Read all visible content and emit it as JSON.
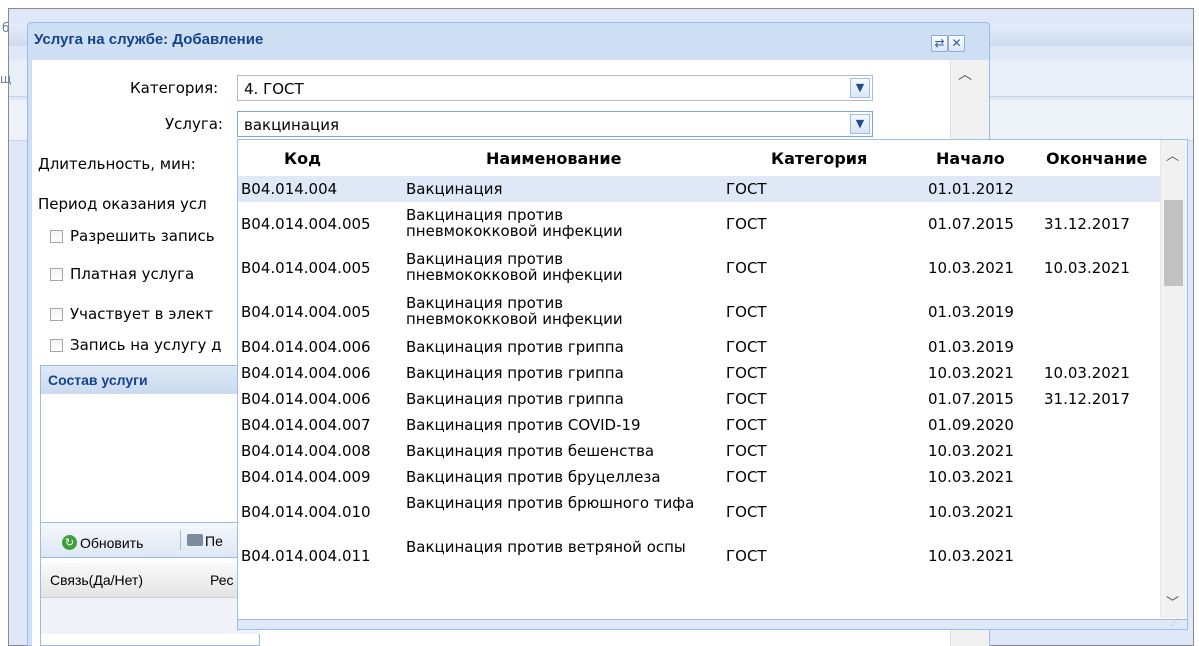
{
  "background": {
    "tab_char_top": "б",
    "tab_char_mid": "щ"
  },
  "dialog": {
    "title": "Услуга на службе: Добавление",
    "refresh_tool": "⇄",
    "close_tool": "✕"
  },
  "form": {
    "category_label": "Категория:",
    "category_value": "4. ГОСТ",
    "service_label": "Услуга:",
    "service_value": "вакцинация",
    "duration_label": "Длительность, мин:",
    "period_label": "Период оказания усл",
    "checkboxes": [
      "Разрешить запись",
      "Платная услуга",
      "Участвует в элект",
      "Запись на услугу д"
    ]
  },
  "composition": {
    "title": "Состав услуги",
    "refresh_label": "Обновить",
    "print_label": "Пе",
    "columns": [
      "Связь(Да/Нет)",
      "Рес"
    ]
  },
  "dropdown": {
    "columns": {
      "code": "Код",
      "name": "Наименование",
      "category": "Категория",
      "start": "Начало",
      "end": "Окончание"
    },
    "rows": [
      {
        "code": "B04.014.004",
        "name": "Вакцинация",
        "category": "ГОСТ",
        "start": "01.01.2012",
        "end": ""
      },
      {
        "code": "B04.014.004.005",
        "name": "Вакцинация против пневмококковой инфекции",
        "category": "ГОСТ",
        "start": "01.07.2015",
        "end": "31.12.2017"
      },
      {
        "code": "B04.014.004.005",
        "name": "Вакцинация против пневмококковой инфекции",
        "category": "ГОСТ",
        "start": "10.03.2021",
        "end": "10.03.2021"
      },
      {
        "code": "B04.014.004.005",
        "name": "Вакцинация против пневмококковой инфекции",
        "category": "ГОСТ",
        "start": "01.03.2019",
        "end": ""
      },
      {
        "code": "B04.014.004.006",
        "name": "Вакцинация против гриппа",
        "category": "ГОСТ",
        "start": "01.03.2019",
        "end": ""
      },
      {
        "code": "B04.014.004.006",
        "name": "Вакцинация против гриппа",
        "category": "ГОСТ",
        "start": "10.03.2021",
        "end": "10.03.2021"
      },
      {
        "code": "B04.014.004.006",
        "name": "Вакцинация против гриппа",
        "category": "ГОСТ",
        "start": "01.07.2015",
        "end": "31.12.2017"
      },
      {
        "code": "B04.014.004.007",
        "name": "Вакцинация против COVID-19",
        "category": "ГОСТ",
        "start": "01.09.2020",
        "end": ""
      },
      {
        "code": "B04.014.004.008",
        "name": "Вакцинация против бешенства",
        "category": "ГОСТ",
        "start": "10.03.2021",
        "end": ""
      },
      {
        "code": "B04.014.004.009",
        "name": "Вакцинация против бруцеллеза",
        "category": "ГОСТ",
        "start": "10.03.2021",
        "end": ""
      },
      {
        "code": "B04.014.004.010",
        "name": "Вакцинация против брюшного тифа",
        "category": "ГОСТ",
        "start": "10.03.2021",
        "end": ""
      },
      {
        "code": "B04.014.004.011",
        "name": "Вакцинация против ветряной оспы",
        "category": "ГОСТ",
        "start": "10.03.2021",
        "end": ""
      }
    ]
  }
}
